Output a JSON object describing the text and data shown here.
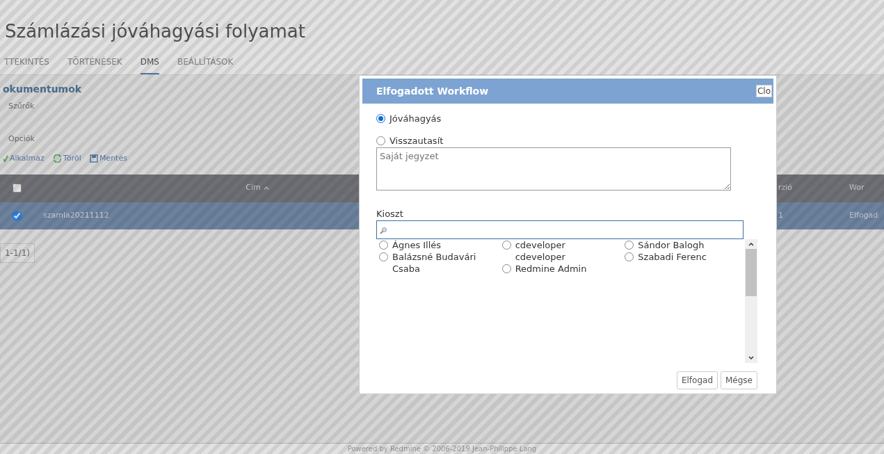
{
  "page_title": "Számlázási jóváhagyási folyamat",
  "tabs": [
    {
      "label": "TTEKINTÉS",
      "selected": false
    },
    {
      "label": "TÖRTÉNÉSEK",
      "selected": false
    },
    {
      "label": "DMS",
      "selected": true
    },
    {
      "label": "BEÁLLÍTÁSOK",
      "selected": false
    }
  ],
  "section_title": "okumentumok",
  "filters": [
    "Szűrők",
    "Opciók"
  ],
  "actions": [
    {
      "kind": "apply",
      "label": "Alkalmaz"
    },
    {
      "kind": "clear",
      "label": "Töröl"
    },
    {
      "kind": "save",
      "label": "Mentés"
    }
  ],
  "table": {
    "select_all_checked": false,
    "columns": [
      "Cím",
      "rzió",
      "Wor"
    ],
    "rows": [
      {
        "checked": true,
        "selected": true,
        "cells": [
          "szamla20211112",
          "1",
          "Elfogad"
        ]
      }
    ]
  },
  "pagination": "1-1/1)",
  "footer": {
    "prefix": "Powered by",
    "link": "Redmine",
    "suffix": "© 2006-2019 Jean-Philippe Lang"
  },
  "dialog": {
    "title": "Elfogadott Workflow",
    "close": "Clo",
    "decisions": [
      {
        "label": "Jóváhagyás",
        "selected": true
      },
      {
        "label": "Visszautasít",
        "selected": false
      }
    ],
    "note": {
      "placeholder": "Saját jegyzet"
    },
    "assign_label": "Kioszt",
    "users": [
      {
        "name": "Ágnes Illés",
        "selected": false
      },
      {
        "name": "Balázsné Budavári Csaba",
        "selected": false
      },
      {
        "name": "cdeveloper cdeveloper",
        "selected": false
      },
      {
        "name": "Redmine Admin",
        "selected": false
      },
      {
        "name": "Sándor Balogh",
        "selected": false
      },
      {
        "name": "Szabadi Ferenc",
        "selected": false
      }
    ],
    "buttons": [
      "Elfogad",
      "Mégse"
    ]
  }
}
